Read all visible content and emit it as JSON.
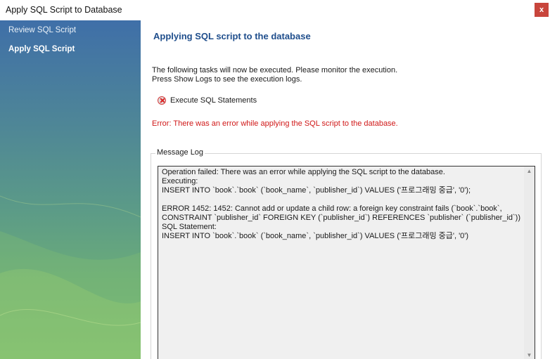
{
  "window": {
    "title": "Apply SQL Script to Database",
    "close_label": "x"
  },
  "sidebar": {
    "items": [
      {
        "label": "Review SQL Script",
        "active": false
      },
      {
        "label": "Apply SQL Script",
        "active": true
      }
    ]
  },
  "main": {
    "heading": "Applying SQL script to the database",
    "description_line1": "The following tasks will now be executed. Please monitor the execution.",
    "description_line2": "Press Show Logs to see the execution logs.",
    "task": {
      "label": "Execute SQL Statements",
      "icon": "error-x-icon",
      "status": "error"
    },
    "error_text": "Error: There was an error while applying the SQL script to the database.",
    "message_log": {
      "legend": "Message Log",
      "text": "Operation failed: There was an error while applying the SQL script to the database.\nExecuting:\nINSERT INTO `book`.`book` (`book_name`, `publisher_id`) VALUES ('프로그래밍 중급', '0');\n\nERROR 1452: 1452: Cannot add or update a child row: a foreign key constraint fails (`book`.`book`,\nCONSTRAINT `publisher_id` FOREIGN KEY (`publisher_id`) REFERENCES `publisher` (`publisher_id`))\nSQL Statement:\nINSERT INTO `book`.`book` (`book_name`, `publisher_id`) VALUES ('프로그래밍 중급', '0')"
    }
  },
  "colors": {
    "heading": "#1f4e8c",
    "error": "#d01818",
    "close_button": "#c8453c",
    "sidebar_top": "#3f6fa8",
    "sidebar_bottom": "#78b973"
  }
}
